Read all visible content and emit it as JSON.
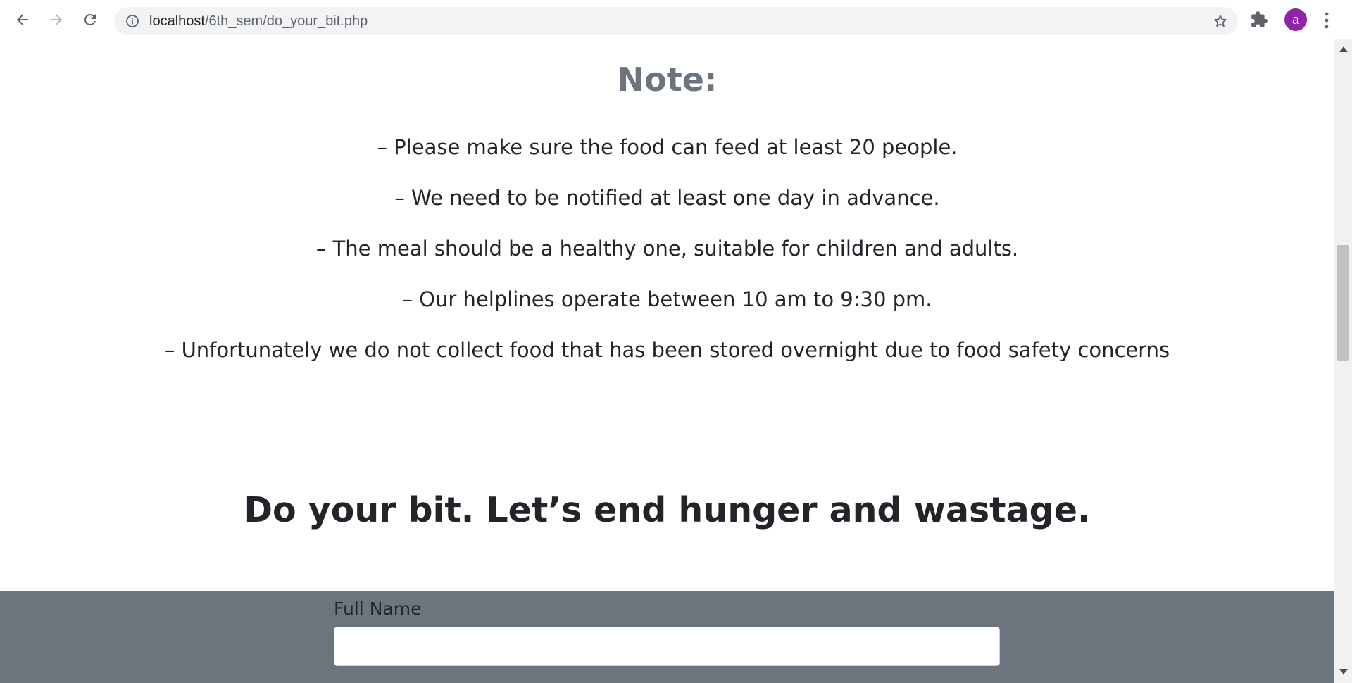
{
  "browser": {
    "url_host": "localhost",
    "url_path": "/6th_sem/do_your_bit.php",
    "avatar_letter": "a",
    "avatar_color": "#8e24aa"
  },
  "note": {
    "title": "Note:",
    "items": [
      "– Please make sure the food can feed at least 20 people.",
      "– We need to be notified at least one day in advance.",
      "– The meal should be a healthy one, suitable for children and adults.",
      "– Our helplines operate between 10 am to 9:30 pm.",
      "– Unfortunately we do not collect food that has been stored overnight due to food safety concerns"
    ]
  },
  "tagline": "Do your bit. Let’s end hunger and wastage.",
  "form": {
    "full_name_label": "Full Name",
    "full_name_value": ""
  },
  "colors": {
    "note_title": "#6c757d",
    "form_band": "#6c757d"
  }
}
